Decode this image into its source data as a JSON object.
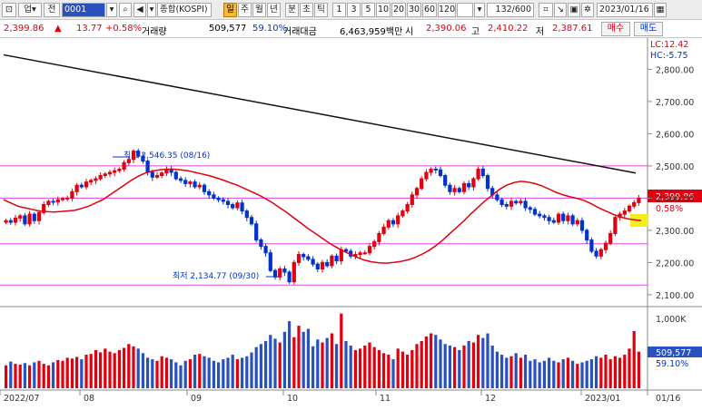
{
  "toolbar": {
    "market_code": "0001",
    "market_name": "종합(KOSPI)",
    "market_type": "업",
    "market_type2": "전",
    "periods": [
      "일",
      "주",
      "월",
      "년",
      "분",
      "초",
      "틱"
    ],
    "period_selected": "일",
    "minutes": [
      "1",
      "3",
      "5",
      "10",
      "20",
      "30",
      "60",
      "120"
    ],
    "count_display": "132/600",
    "date": "2023/01/16"
  },
  "quote": {
    "price": "2,399.86",
    "change_arrow": "▲",
    "change": "13.77",
    "change_pct": "+0.58%",
    "volume_label": "거래량",
    "volume": "509,577",
    "volume_pct": "59.10%",
    "amount_label": "거래대금",
    "amount": "6,463,959백만",
    "open_label": "시",
    "open": "2,390.06",
    "high_label": "고",
    "high": "2,410.22",
    "low_label": "저",
    "low": "2,387.61",
    "buy_label": "매수",
    "sell_label": "매도"
  },
  "chart_data": {
    "type": "candlestick",
    "price_axis": {
      "labels": [
        "2,800.00",
        "2,700.00",
        "2,600.00",
        "2,500.00",
        "2,400.00",
        "2,300.00",
        "2,200.00",
        "2,100.00"
      ],
      "ylim": [
        2080,
        2880
      ]
    },
    "top_right": {
      "lc": "LC:12.42",
      "hc": "HC:-5.75"
    },
    "current_price_label": "2,399.86",
    "current_pct_label": "0.58%",
    "annotations": {
      "high": "최고 2,546.35 (08/16)",
      "low": "최저 2,134.77 (09/30)"
    },
    "horizontal_lines": [
      2500,
      2400,
      2258,
      2130
    ],
    "x_axis_labels": [
      "2022/07",
      "08",
      "09",
      "10",
      "11",
      "12",
      "2023/01",
      "01/16"
    ],
    "volume_axis": {
      "label": "1,000K",
      "current": "509,577",
      "current_pct": "59.10%"
    },
    "closes": [
      2330,
      2325,
      2338,
      2345,
      2320,
      2350,
      2330,
      2355,
      2380,
      2390,
      2388,
      2395,
      2398,
      2400,
      2420,
      2440,
      2435,
      2450,
      2455,
      2460,
      2470,
      2475,
      2480,
      2485,
      2490,
      2510,
      2520,
      2546,
      2530,
      2515,
      2480,
      2465,
      2470,
      2478,
      2490,
      2480,
      2460,
      2455,
      2445,
      2450,
      2435,
      2440,
      2420,
      2410,
      2400,
      2395,
      2390,
      2380,
      2370,
      2385,
      2360,
      2340,
      2320,
      2270,
      2250,
      2230,
      2175,
      2155,
      2180,
      2170,
      2140,
      2200,
      2225,
      2218,
      2210,
      2195,
      2180,
      2200,
      2190,
      2220,
      2205,
      2240,
      2235,
      2220,
      2225,
      2230,
      2230,
      2250,
      2265,
      2290,
      2310,
      2330,
      2320,
      2345,
      2360,
      2380,
      2410,
      2430,
      2460,
      2480,
      2490,
      2488,
      2470,
      2440,
      2420,
      2430,
      2420,
      2445,
      2435,
      2460,
      2490,
      2470,
      2430,
      2410,
      2395,
      2380,
      2375,
      2390,
      2385,
      2390,
      2370,
      2365,
      2350,
      2345,
      2340,
      2330,
      2325,
      2350,
      2330,
      2345,
      2320,
      2330,
      2300,
      2270,
      2235,
      2220,
      2240,
      2260,
      2290,
      2340,
      2350,
      2360,
      2375,
      2386,
      2399.86
    ],
    "ma_short": [
      2395,
      2385,
      2375,
      2370,
      2365,
      2360,
      2358,
      2357,
      2358,
      2360,
      2362,
      2368,
      2375,
      2385,
      2395,
      2410,
      2425,
      2440,
      2455,
      2468,
      2478,
      2484,
      2488,
      2490,
      2490,
      2488,
      2485,
      2480,
      2475,
      2470,
      2463,
      2456,
      2448,
      2440,
      2430,
      2420,
      2410,
      2398,
      2385,
      2370,
      2355,
      2338,
      2322,
      2305,
      2290,
      2275,
      2260,
      2247,
      2235,
      2225,
      2215,
      2207,
      2202,
      2199,
      2198,
      2200,
      2203,
      2208,
      2215,
      2225,
      2237,
      2252,
      2270,
      2290,
      2310,
      2330,
      2352,
      2372,
      2392,
      2410,
      2427,
      2440,
      2448,
      2452,
      2450,
      2445,
      2438,
      2428,
      2418,
      2410,
      2404,
      2399,
      2392,
      2382,
      2370,
      2360,
      2350,
      2342,
      2336,
      2333,
      2330
    ],
    "ma_long_start": 2845,
    "ma_long_end": 2478,
    "volumes": [
      0.3,
      0.35,
      0.32,
      0.31,
      0.33,
      0.3,
      0.34,
      0.36,
      0.32,
      0.3,
      0.34,
      0.37,
      0.36,
      0.4,
      0.39,
      0.41,
      0.38,
      0.44,
      0.45,
      0.5,
      0.47,
      0.52,
      0.48,
      0.46,
      0.5,
      0.53,
      0.58,
      0.55,
      0.52,
      0.46,
      0.4,
      0.38,
      0.36,
      0.42,
      0.4,
      0.38,
      0.34,
      0.3,
      0.36,
      0.38,
      0.44,
      0.45,
      0.42,
      0.4,
      0.36,
      0.34,
      0.38,
      0.4,
      0.44,
      0.38,
      0.4,
      0.42,
      0.47,
      0.54,
      0.58,
      0.62,
      0.7,
      0.65,
      0.6,
      0.74,
      0.88,
      0.67,
      0.82,
      0.74,
      0.78,
      0.55,
      0.64,
      0.6,
      0.66,
      0.72,
      0.58,
      0.98,
      0.62,
      0.56,
      0.5,
      0.52,
      0.56,
      0.6,
      0.54,
      0.5,
      0.46,
      0.44,
      0.38,
      0.52,
      0.48,
      0.44,
      0.5,
      0.58,
      0.62,
      0.68,
      0.72,
      0.7,
      0.64,
      0.58,
      0.56,
      0.54,
      0.5,
      0.56,
      0.62,
      0.6,
      0.7,
      0.66,
      0.72,
      0.56,
      0.48,
      0.44,
      0.4,
      0.42,
      0.46,
      0.4,
      0.44,
      0.36,
      0.38,
      0.34,
      0.36,
      0.4,
      0.36,
      0.34,
      0.38,
      0.4,
      0.36,
      0.32,
      0.34,
      0.36,
      0.38,
      0.42,
      0.4,
      0.44,
      0.38,
      0.42,
      0.4,
      0.44,
      0.52,
      0.75,
      0.48
    ]
  }
}
